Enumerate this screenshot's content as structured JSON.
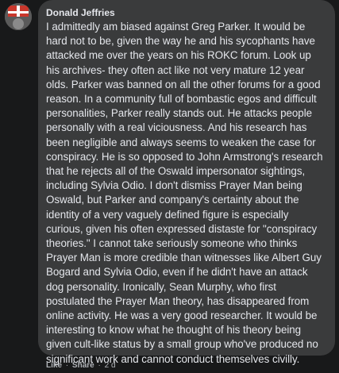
{
  "comment": {
    "author": "Donald Jeffries",
    "text": "I admittedly am biased against Greg Parker. It would be hard not to be, given the way he and his sycophants have attacked me over the years on his ROKC forum. Look up his archives- they often act like not very mature 12 year olds. Parker was banned on all the other forums for a good reason. In a community full of bombastic egos and difficult personalities, Parker really stands out. He attacks people personally with a real viciousness. And his research has been negligible and always seems to weaken the case for conspiracy. He is so opposed to John Armstrong's research that he rejects all of the Oswald impersonator sightings, including Sylvia Odio. I don't dismiss Prayer Man being Oswald, but Parker and company's certainty about the identity of a very vaguely defined figure is especially curious, given his often expressed distaste for \"conspiracy theories.\" I cannot take seriously someone who thinks Prayer Man is more credible than witnesses like Albert Guy Bogard and Sylvia Odio, even if he didn't have an attack dog personality. Ironically, Sean Murphy, who first postulated the Prayer Man theory, has disappeared from online activity. He was a very good researcher. It would be interesting to know what he thought of his theory being given cult-like status by a small group who've produced no significant work and cannot conduct themselves civilly.",
    "actions": {
      "like": "Like",
      "separator": "·",
      "share": "Share",
      "time": "2 d"
    }
  },
  "colors": {
    "background": "#18191a",
    "bubble": "#3a3b3c",
    "text": "#e4e6eb",
    "meta": "#b0b3b8"
  },
  "icons": {
    "avatar": "user-avatar-red-flag"
  }
}
